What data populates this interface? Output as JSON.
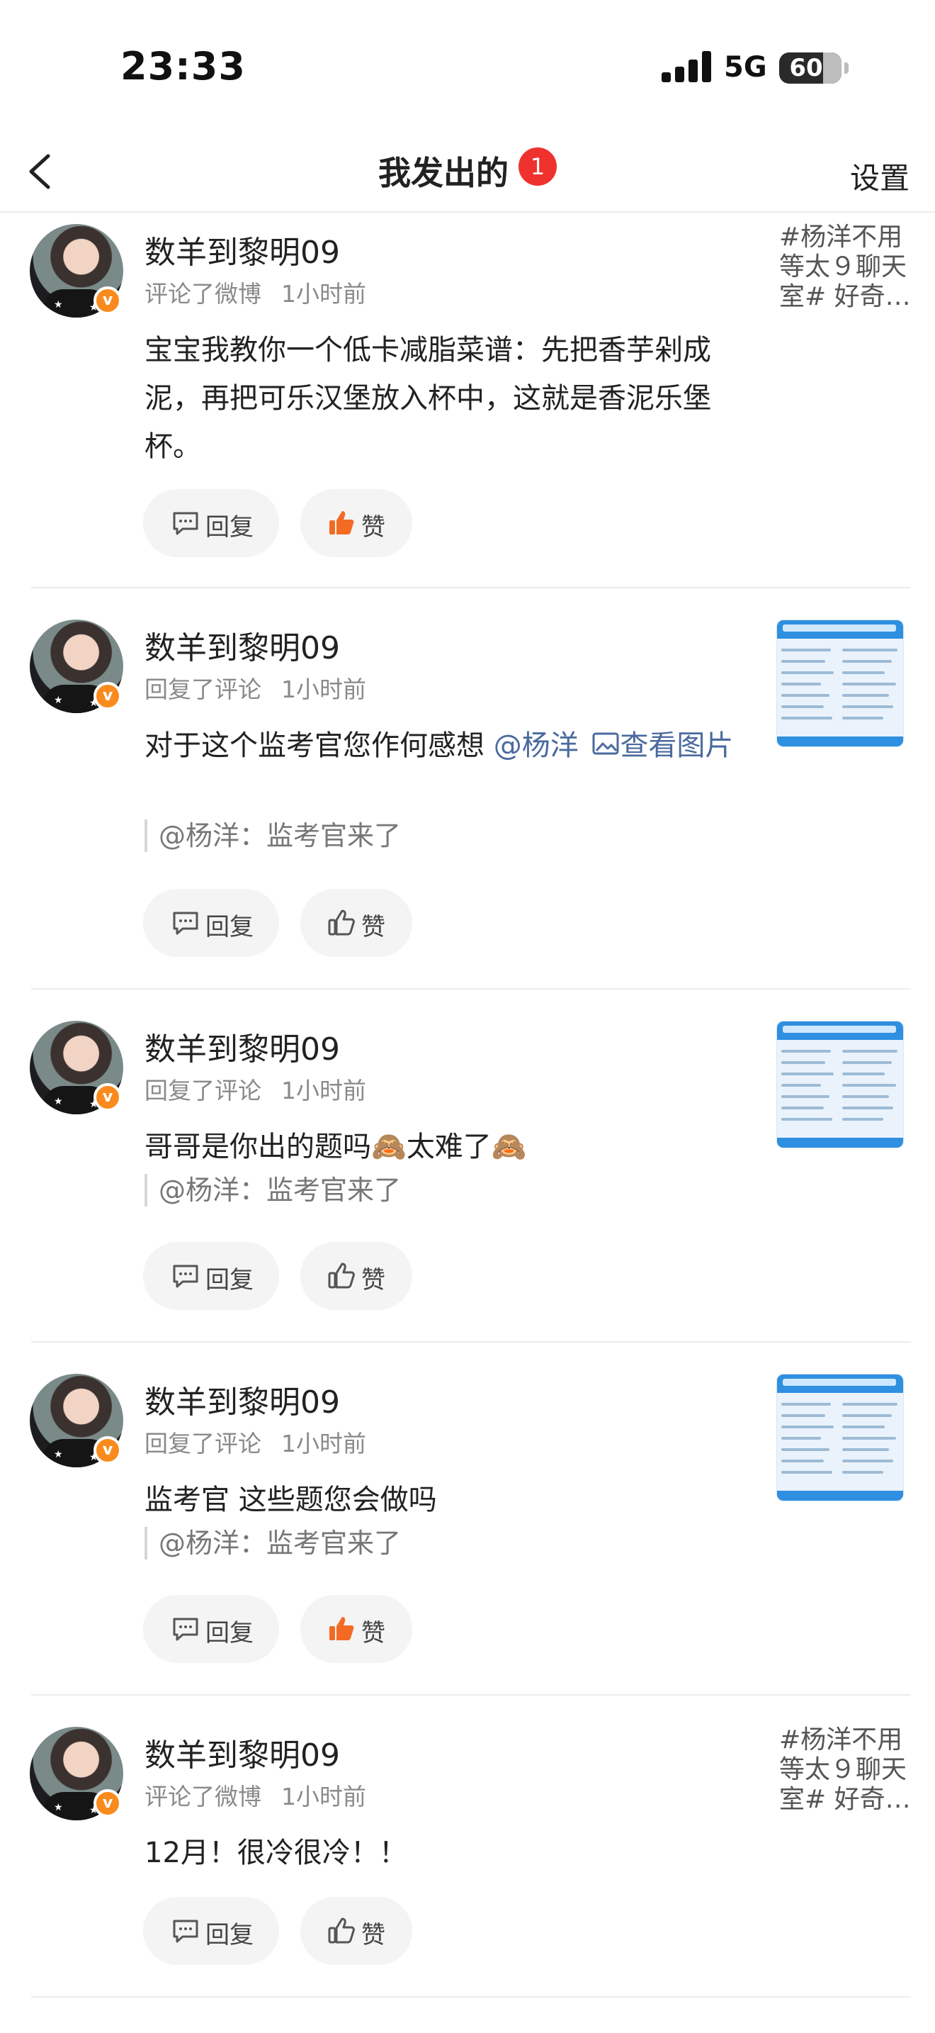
{
  "status_bar": {
    "time": "23:33",
    "network": "5G",
    "battery": "60"
  },
  "nav": {
    "title": "我发出的",
    "badge": "1",
    "settings": "设置"
  },
  "buttons": {
    "reply": "回复",
    "like": "赞"
  },
  "verified_mark": "v",
  "colors": {
    "accent_orange": "#f98b1e",
    "badge_red": "#f0322e",
    "link_blue": "#4a6a9e",
    "like_orange": "#f36b23"
  },
  "items": [
    {
      "username": "数羊到黎明09",
      "action": "评论了微博",
      "time_ago": "1小时前",
      "content": "宝宝我教你一个低卡减脂菜谱：先把香芋剁成泥，再把可乐汉堡放入杯中，这就是香泥乐堡杯。",
      "side_text": "#杨洋不用等太９聊天室# 好奇…",
      "liked": true
    },
    {
      "username": "数羊到黎明09",
      "action": "回复了评论",
      "time_ago": "1小时前",
      "content": "对于这个监考官您作何感想",
      "mention": "@杨洋",
      "image_link": "查看图片",
      "quote": "@杨洋：监考官来了",
      "side_icon": "document-thumbnail",
      "liked": false
    },
    {
      "username": "数羊到黎明09",
      "action": "回复了评论",
      "time_ago": "1小时前",
      "content_a": "哥哥是你出的题吗",
      "content_b": "太难了",
      "emoji": "🙈",
      "quote": "@杨洋：监考官来了",
      "side_icon": "document-thumbnail",
      "liked": false
    },
    {
      "username": "数羊到黎明09",
      "action": "回复了评论",
      "time_ago": "1小时前",
      "content": "监考官 这些题您会做吗",
      "quote": "@杨洋：监考官来了",
      "side_icon": "document-thumbnail",
      "liked": true
    },
    {
      "username": "数羊到黎明09",
      "action": "评论了微博",
      "time_ago": "1小时前",
      "content": "12月！很冷很冷！！",
      "side_text": "#杨洋不用等太９聊天室# 好奇…",
      "liked": false
    }
  ]
}
